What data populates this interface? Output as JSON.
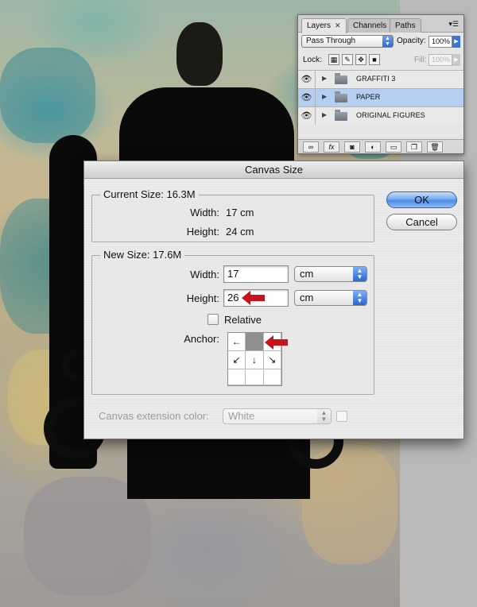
{
  "layers_panel": {
    "tabs": [
      {
        "label": "Layers",
        "active": true
      },
      {
        "label": "Channels",
        "active": false
      },
      {
        "label": "Paths",
        "active": false
      }
    ],
    "blend_mode": "Pass Through",
    "opacity_label": "Opacity:",
    "opacity_value": "100%",
    "lock_label": "Lock:",
    "fill_label": "Fill:",
    "fill_value": "100%",
    "layers": [
      {
        "name": "GRAFFITI 3",
        "visible": true,
        "selected": false
      },
      {
        "name": "PAPER",
        "visible": true,
        "selected": true
      },
      {
        "name": "ORIGINAL FIGURES",
        "visible": true,
        "selected": false
      }
    ],
    "footer_fx_label": "fx"
  },
  "dialog": {
    "title": "Canvas Size",
    "current": {
      "title": "Current Size: 16.3M",
      "width_label": "Width:",
      "width_value": "17 cm",
      "height_label": "Height:",
      "height_value": "24 cm"
    },
    "new": {
      "title": "New Size: 17.6M",
      "width_label": "Width:",
      "width_value": "17",
      "width_unit": "cm",
      "height_label": "Height:",
      "height_value": "26",
      "height_unit": "cm",
      "relative_label": "Relative",
      "anchor_label": "Anchor:"
    },
    "extension_label": "Canvas extension color:",
    "extension_value": "White",
    "ok_label": "OK",
    "cancel_label": "Cancel"
  },
  "colors": {
    "highlight_arrow": "#c8121c",
    "selected_layer": "#b5cff3",
    "default_button": "#4f8ae6"
  }
}
